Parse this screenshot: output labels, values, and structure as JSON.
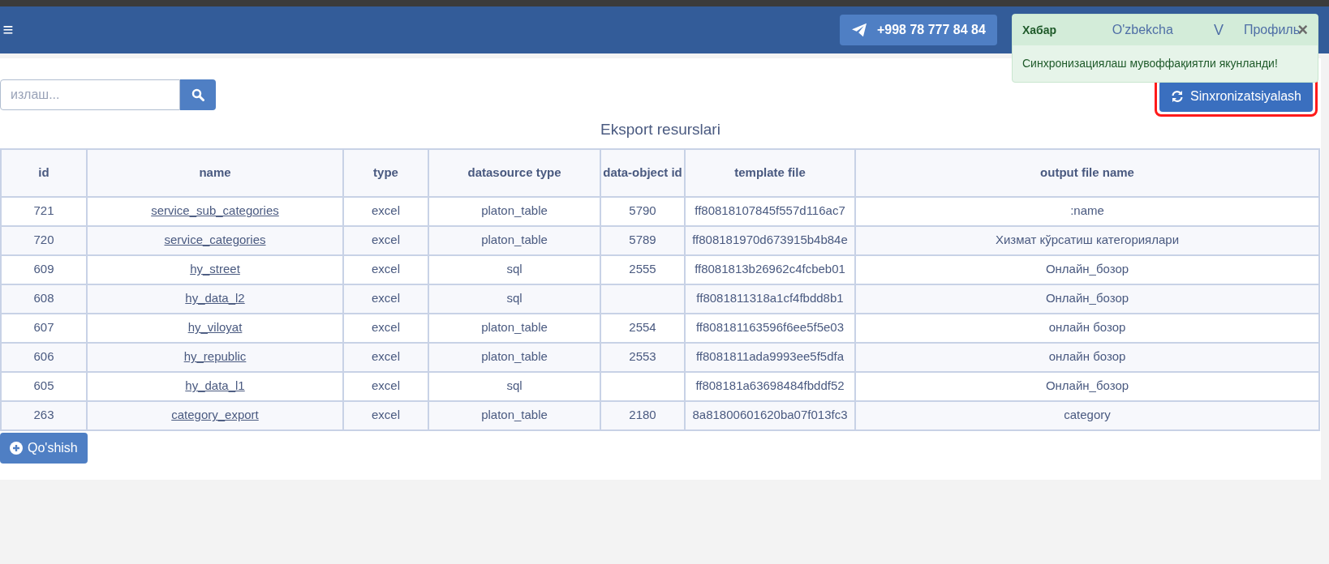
{
  "header": {
    "menu_icon": "≡",
    "phone": "+998 78 777 84 84",
    "language": "O'zbekcha",
    "user_initial": "V",
    "profile": "Профиль"
  },
  "toast": {
    "title": "Хабар",
    "close": "×",
    "message": "Синхронизациялаш мувоффақиятли якунланди!"
  },
  "search": {
    "placeholder": "излаш..."
  },
  "sync_button": {
    "label": "Sinxronizatsiyalash",
    "highlighted": true
  },
  "table": {
    "title": "Eksport resurslari",
    "columns": [
      "id",
      "name",
      "type",
      "datasource type",
      "data-object id",
      "template file",
      "output file name"
    ],
    "rows": [
      [
        "721",
        "service_sub_categories",
        "excel",
        "platon_table",
        "5790",
        "ff80818107845f557d116ac7",
        ":name"
      ],
      [
        "720",
        "service_categories",
        "excel",
        "platon_table",
        "5789",
        "ff808181970d673915b4b84e",
        "Хизмат кўрсатиш категориялари"
      ],
      [
        "609",
        "hy_street",
        "excel",
        "sql",
        "2555",
        "ff8081813b26962c4fcbeb01",
        "Онлайн_бозор"
      ],
      [
        "608",
        "hy_data_l2",
        "excel",
        "sql",
        "",
        "ff8081811318a1cf4fbdd8b1",
        "Онлайн_бозор"
      ],
      [
        "607",
        "hy_viloyat",
        "excel",
        "platon_table",
        "2554",
        "ff808181163596f6ee5f5e03",
        "онлайн бозор"
      ],
      [
        "606",
        "hy_republic",
        "excel",
        "platon_table",
        "2553",
        "ff8081811ada9993ee5f5dfa",
        "онлайн бозор"
      ],
      [
        "605",
        "hy_data_l1",
        "excel",
        "sql",
        "",
        "ff808181a63698484fbddf52",
        "Онлайн_бозор"
      ],
      [
        "263",
        "category_export",
        "excel",
        "platon_table",
        "2180",
        "8a81800601620ba07f013fc3",
        "category"
      ]
    ]
  },
  "add_button": {
    "label": "Qo'shish"
  }
}
